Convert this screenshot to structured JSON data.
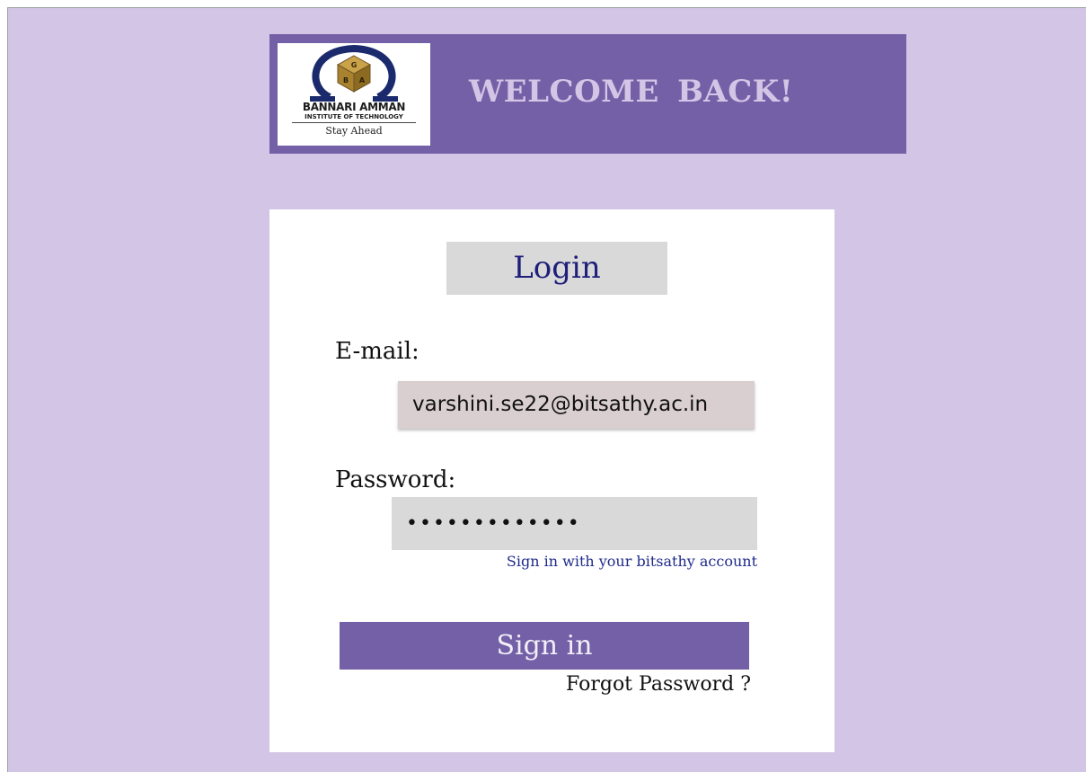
{
  "header": {
    "logo_name": "BANNARI AMMAN",
    "logo_subtitle": "INSTITUTE OF TECHNOLOGY",
    "logo_tagline": "Stay Ahead",
    "welcome_text": "WELCOME  BACK!"
  },
  "login": {
    "title": "Login",
    "email_label": "E-mail:",
    "email_value": "varshini.se22@bitsathy.ac.in",
    "password_label": "Password:",
    "password_mask": "•••••••••••••",
    "account_hint": "Sign in with your bitsathy account",
    "signin_label": "Sign in",
    "forgot_label": "Forgot Password ?"
  },
  "colors": {
    "page_background": "#d3c5e6",
    "banner": "#7460a7",
    "login_title_text": "#1f1e7a",
    "email_field": "#d9cfd0",
    "field_grey": "#d9d9d9",
    "link_blue": "#1f2a8a"
  },
  "icons": {
    "logo": "omega-cube-logo-icon"
  }
}
